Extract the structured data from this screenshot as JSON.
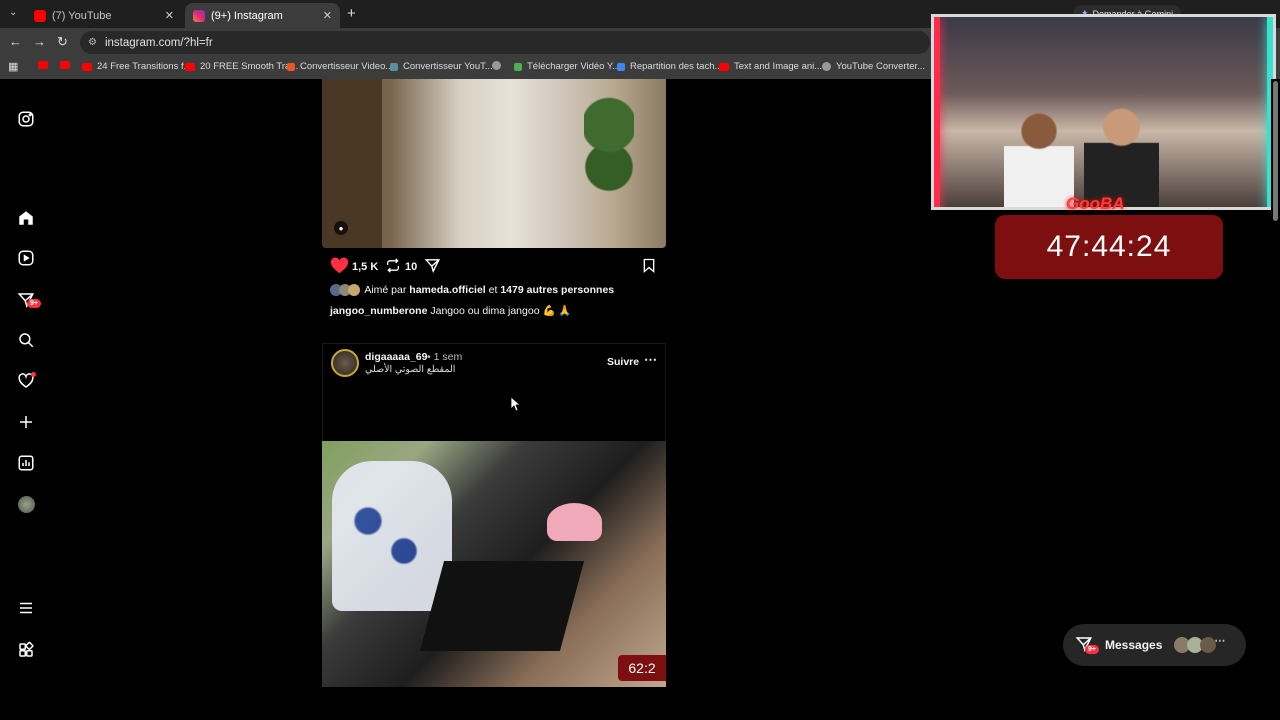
{
  "browser": {
    "tabs": [
      {
        "title": "(7) YouTube",
        "favicon": "youtube-icon",
        "active": false
      },
      {
        "title": "(9+) Instagram",
        "favicon": "instagram-icon",
        "active": true
      }
    ],
    "url": "instagram.com/?hl=fr",
    "gemini_button": "Demander à Gemini",
    "bookmarks": [
      "24 Free Transitions f...",
      "20 FREE Smooth Tra...",
      "Convertisseur Video...",
      "Convertisseur YouT...",
      "Télécharger Vidéo Y...",
      "Repartition des tach...",
      "Text and Image ani...",
      "YouTube Converter..."
    ]
  },
  "sidebar": {
    "notifications_badge": "9+",
    "items": [
      "instagram-logo-icon",
      "home-icon",
      "reels-icon",
      "messages-icon",
      "search-icon",
      "notifications-icon",
      "create-icon",
      "dashboard-icon",
      "profile-avatar",
      "menu-icon",
      "more-apps-icon"
    ]
  },
  "post1": {
    "likes_count": "1,5 K",
    "reposts_count": "10",
    "liked_by_prefix": "Aimé par",
    "liked_by_user": "hameda.officiel",
    "liked_by_and": "et",
    "liked_by_others": "1479 autres personnes",
    "caption_user": "jangoo_numberone",
    "caption_text": "Jangoo ou dima jangoo 💪 🙏"
  },
  "post2": {
    "username": "digaaaaa_69",
    "time": "• 1 sem",
    "audio": "المقطع الصوتي الأصلي",
    "follow": "Suivre",
    "video_overlay": "62:2"
  },
  "overlay": {
    "timer": "47:44:24",
    "logo_text": "GooBA"
  },
  "messages": {
    "label": "Messages",
    "badge": "9+"
  },
  "colors": {
    "like_red": "#ff3040",
    "timer_bg": "#7d0f10"
  }
}
